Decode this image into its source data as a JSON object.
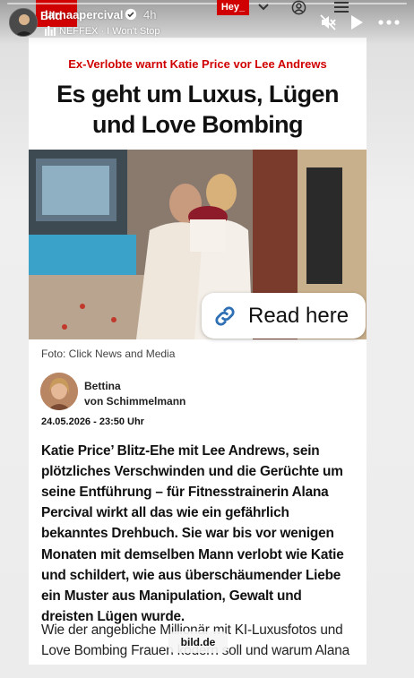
{
  "story": {
    "username": "larnaapercival",
    "time_ago": "4h",
    "music": "NEFFEX · I Won't Stop",
    "icons": [
      "music-icon",
      "verified-icon",
      "mute-icon",
      "play-icon",
      "more-icon",
      "chevron-down-icon",
      "account-icon",
      "menu-icon"
    ],
    "link_sticker_label": "Read here",
    "link_domain": "bild.de"
  },
  "site_header": {
    "logo_text": "Bild",
    "hey_label": "Hey_"
  },
  "article": {
    "kicker": "Ex-Verlobte warnt Katie Price vor Lee Andrews",
    "headline": "Es geht um Luxus, Lügen und Love Bombing",
    "photo_caption": "Foto: Click News and Media",
    "author_first": "Bettina",
    "author_last": "von Schimmelmann",
    "date": "24.05.2026 - 23:50 Uhr",
    "lead": "Katie Price’ Blitz-Ehe mit Lee Andrews, sein plötzliches Verschwinden und die Gerüchte um seine Entführung – für Fitnesstrainerin Alana Percival wirkt all das wie ein gefährlich bekanntes Drehbuch. Sie war bis vor wenigen Monaten mit demselben Mann verlobt wie Katie und schildert, wie aus überschäumender Liebe ein Muster aus Manipulation, Gewalt und dreisten Lügen wurde.",
    "body": "Wie der angebliche Millionär mit KI-Luxusfotos und Love Bombing Frauen ködern soll und warum Alana"
  },
  "colors": {
    "brand_red": "#d00000",
    "text_dark": "#111111",
    "background": "#e9e9e9"
  }
}
